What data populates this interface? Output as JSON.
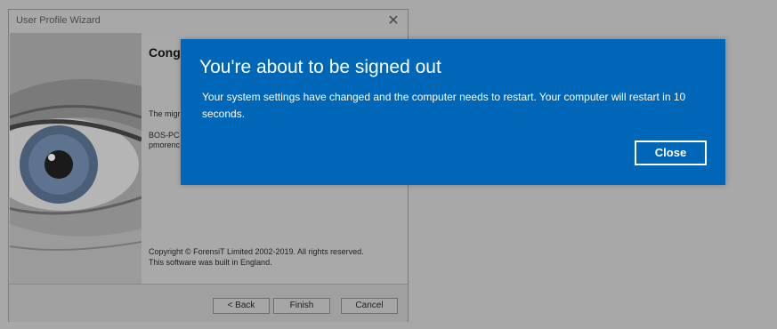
{
  "wizard": {
    "title": "User Profile Wizard",
    "close_glyph": "✕",
    "heading": "Cong",
    "line_migration": "The migr",
    "line_computer": "BOS-PC",
    "line_user": "pmorenc",
    "copyright_line1": "Copyright © ForensiT Limited 2002-2019. All rights reserved.",
    "copyright_line2": "This software was built in England.",
    "buttons": {
      "back": "< Back",
      "finish": "Finish",
      "cancel": "Cancel"
    }
  },
  "notification": {
    "title": "You're about to be signed out",
    "message": "Your system settings have changed and the computer needs to restart. Your computer will restart in 10 seconds.",
    "close_label": "Close",
    "background_color": "#0067b8"
  }
}
